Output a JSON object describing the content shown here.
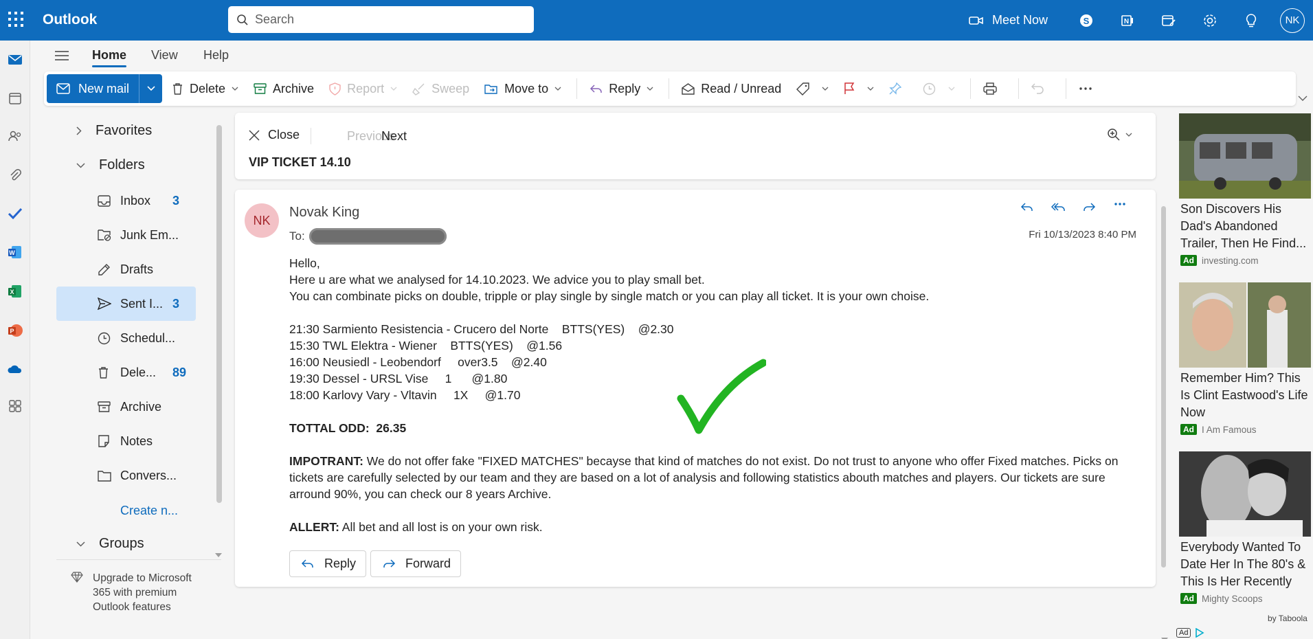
{
  "app": {
    "title": "Outlook",
    "avatar_initials": "NK",
    "accent": "#0f6cbd"
  },
  "search": {
    "placeholder": "Search"
  },
  "topbar": {
    "meet_now": "Meet Now"
  },
  "ribbon": {
    "tabs": [
      "Home",
      "View",
      "Help"
    ],
    "new_mail": "New mail",
    "delete": "Delete",
    "archive": "Archive",
    "report": "Report",
    "sweep": "Sweep",
    "move_to": "Move to",
    "reply": "Reply",
    "read_unread": "Read / Unread"
  },
  "folders": {
    "favorites": "Favorites",
    "folders_header": "Folders",
    "items": [
      {
        "label": "Inbox",
        "count": "3"
      },
      {
        "label": "Junk Em...",
        "count": ""
      },
      {
        "label": "Drafts",
        "count": ""
      },
      {
        "label": "Sent I...",
        "count": "3"
      },
      {
        "label": "Schedul...",
        "count": ""
      },
      {
        "label": "Dele...",
        "count": "89"
      },
      {
        "label": "Archive",
        "count": ""
      },
      {
        "label": "Notes",
        "count": ""
      },
      {
        "label": "Convers...",
        "count": ""
      }
    ],
    "create_new": "Create n...",
    "groups": "Groups",
    "upgrade": "Upgrade to Microsoft 365 with premium Outlook features"
  },
  "reading": {
    "close": "Close",
    "previous": "Previous",
    "next": "Next",
    "subject": "VIP TICKET 14.10"
  },
  "message": {
    "avatar": "NK",
    "sender": "Novak King",
    "to_label": "To:",
    "date": "Fri 10/13/2023 8:40 PM",
    "greeting": "Hello,",
    "line1": "Here u are what we analysed for 14.10.2023. We advice you to play small bet.",
    "line2": "You can combinate picks on double, tripple or play single by single match or you can play all ticket. It is your own choise.",
    "picks": [
      "21:30 Sarmiento Resistencia - Crucero del Norte    BTTS(YES)    @2.30",
      "15:30 TWL Elektra - Wiener    BTTS(YES)    @1.56",
      "16:00 Neusiedl - Leobendorf     over3.5    @2.40",
      "19:30 Dessel - URSL Vise     1      @1.80",
      "18:00 Karlovy Vary - Vltavin     1X     @1.70"
    ],
    "total_label": "TOTTAL ODD:  26.35",
    "important_label": "IMPOTRANT:",
    "important_text": " We do not offer fake \"FIXED MATCHES\" becayse that kind of matches do not exist. Do not trust to anyone who offer Fixed matches. Picks on tickets are carefully selected by our team and they are based on a lot of analysis and following statistics abouth matches and players. Our tickets are sure arround 90%, you can check our 8 years Archive.",
    "alert_label": "ALLERT:",
    "alert_text": " All bet and all lost is on your own risk.",
    "reply_btn": "Reply",
    "forward_btn": "Forward"
  },
  "ads": [
    {
      "title": "Son Discovers His Dad's Abandoned Trailer, Then He Find...",
      "badge": "Ad",
      "source": "investing.com"
    },
    {
      "title": "Remember Him? This Is Clint Eastwood's Life Now",
      "badge": "Ad",
      "source": "I Am Famous"
    },
    {
      "title": "Everybody Wanted To Date Her In The 80's & This Is Her Recently",
      "badge": "Ad",
      "source": "Mighty Scoops"
    }
  ],
  "ads_footer": {
    "by": "by Taboola",
    "badge": "Ad"
  }
}
